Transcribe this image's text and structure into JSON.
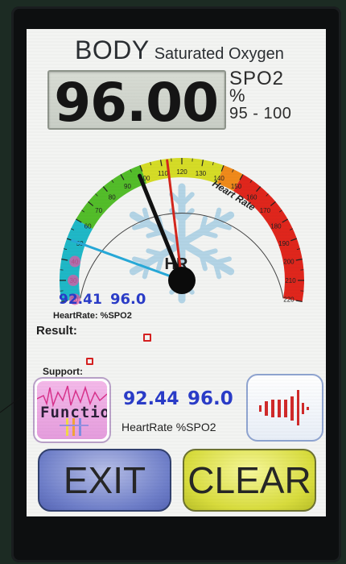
{
  "title": {
    "main": "BODY",
    "sub": "Saturated Oxygen"
  },
  "display": {
    "value": "96.00",
    "unit_label": "SPO2",
    "unit_symbol": "%",
    "range": "95 - 100"
  },
  "gauge": {
    "ticks": [
      "20",
      "30",
      "40",
      "50",
      "60",
      "70",
      "80",
      "90",
      "100",
      "110",
      "120",
      "130",
      "140",
      "150",
      "160",
      "170",
      "180",
      "190",
      "200",
      "210",
      "220"
    ],
    "label": "Heart Rate",
    "center_label": "HR",
    "spo2_needle_value": 50,
    "black_needle_value": 98,
    "red_needle_value": 113
  },
  "readout_top": {
    "heart_rate": "92.41",
    "spo2": "96.0",
    "labels": "HeartRate: %SPO2"
  },
  "result_label": "Result:",
  "support_label": "Support:",
  "function_button_label": "Function",
  "readout_bottom": {
    "heart_rate": "92.44",
    "spo2": "96.0",
    "labels": "HeartRate %SPO2"
  },
  "buttons": {
    "exit": "EXIT",
    "clear": "CLEAR"
  },
  "colors": {
    "blue_readout": "#2a3cc8",
    "needle_blue": "#27a9d8",
    "needle_red": "#d3261c",
    "needle_black": "#111111"
  }
}
